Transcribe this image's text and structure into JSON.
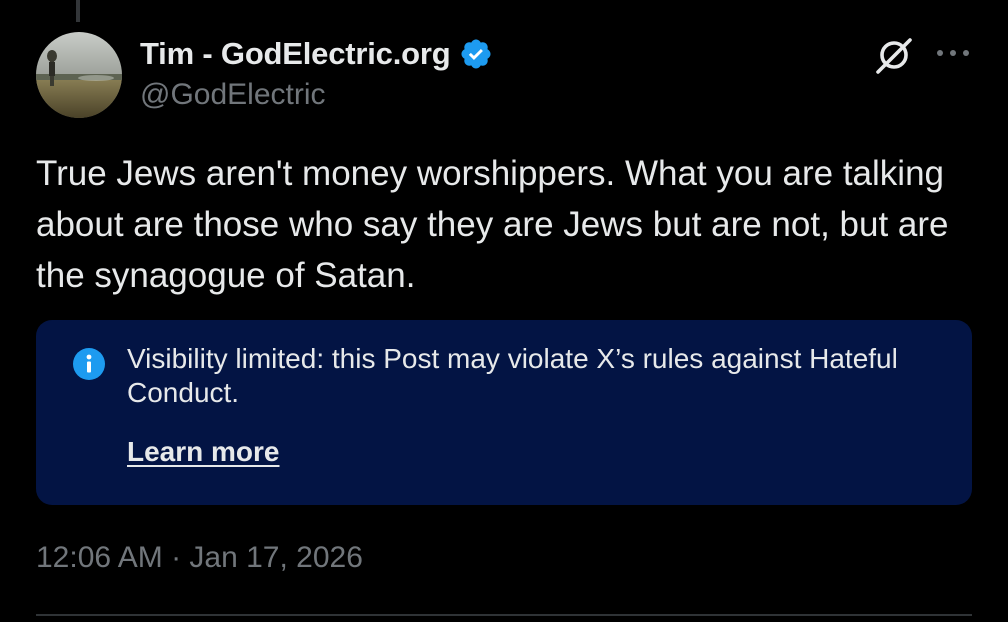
{
  "post": {
    "author": {
      "display_name": "Tim - GodElectric.org",
      "handle": "@GodElectric",
      "verified": true,
      "verified_color": "#1d9bf0"
    },
    "text": "True Jews aren't money worshippers. What you are talking about are those who say they are Jews but are not, but are the synagogue of Satan.",
    "notice": {
      "text": "Visibility limited: this Post may violate X’s rules against Hateful Conduct.",
      "link_label": "Learn more",
      "background": "#031444",
      "icon": "info-icon"
    },
    "timestamp": "12:06 AM · Jan 17, 2026",
    "header_icons": [
      "grok-icon",
      "more-icon"
    ]
  },
  "colors": {
    "background": "#000000",
    "primary_text": "#e7e9ea",
    "secondary_text": "#71767b",
    "accent": "#1d9bf0"
  }
}
